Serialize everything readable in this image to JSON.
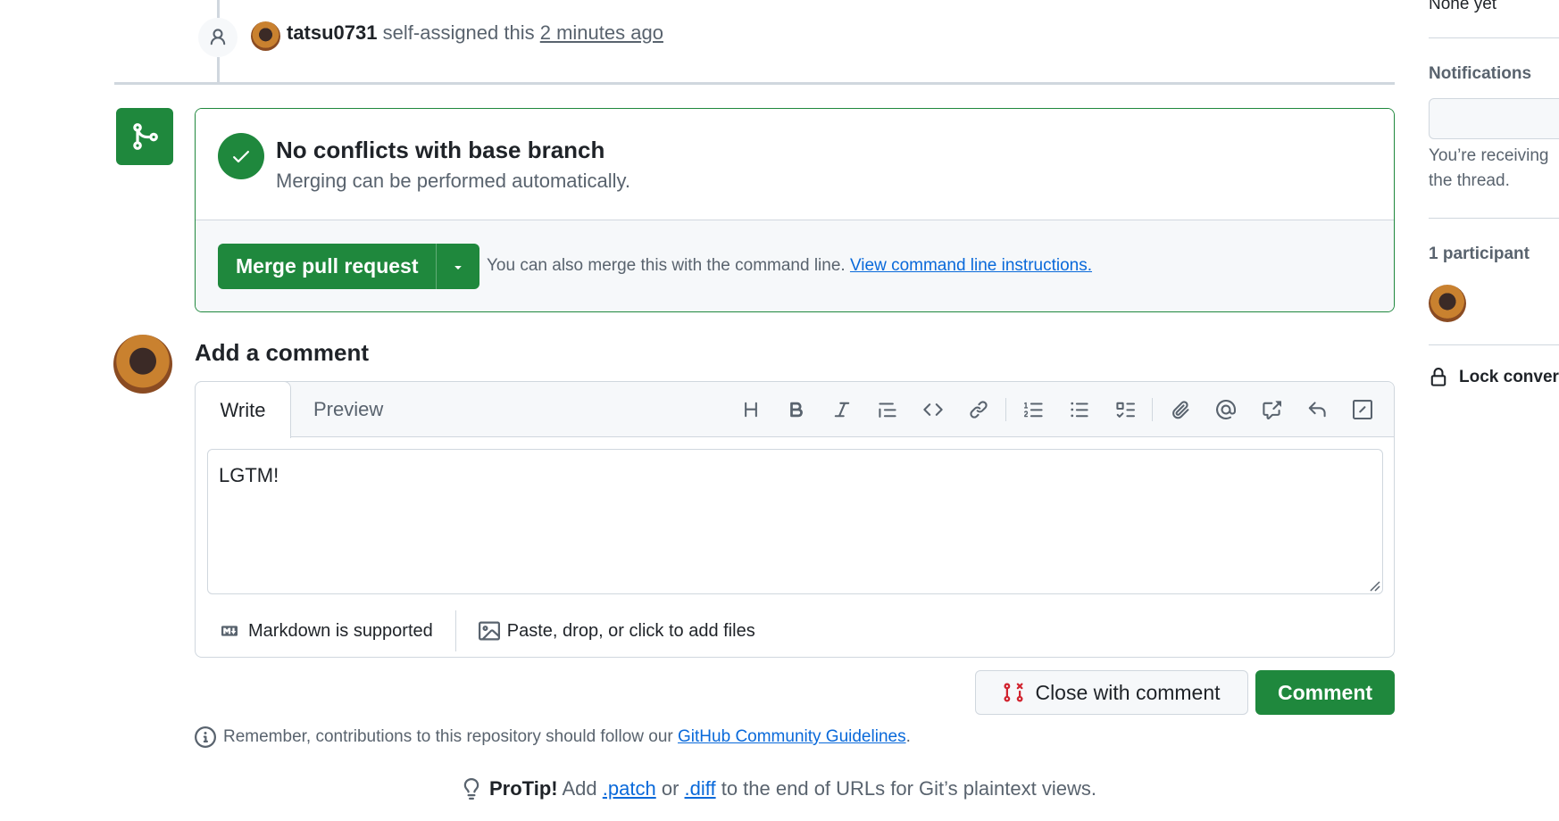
{
  "timeline_event": {
    "username": "tatsu0731",
    "action": "self-assigned this",
    "time": "2 minutes ago"
  },
  "merge": {
    "title": "No conflicts with base branch",
    "subtitle": "Merging can be performed automatically.",
    "button_label": "Merge pull request",
    "cli_text": "You can also merge this with the command line.",
    "cli_link": "View command line instructions."
  },
  "comment": {
    "heading": "Add a comment",
    "tabs": {
      "write": "Write",
      "preview": "Preview"
    },
    "toolbar": [
      "heading-icon",
      "bold-icon",
      "italic-icon",
      "quote-icon",
      "code-icon",
      "link-icon",
      "ordered-list-icon",
      "unordered-list-icon",
      "task-list-icon",
      "attach-icon",
      "mention-icon",
      "cross-reference-icon",
      "saved-reply-icon",
      "slash-command-icon"
    ],
    "text": "LGTM!",
    "markdown_note": "Markdown is supported",
    "files_note": "Paste, drop, or click to add files",
    "close_button": "Close with comment",
    "comment_button": "Comment"
  },
  "guidelines": {
    "text": "Remember, contributions to this repository should follow our",
    "link": "GitHub Community Guidelines",
    "end": "."
  },
  "protip": {
    "label": "ProTip!",
    "add": "Add",
    "patch": ".patch",
    "or": "or",
    "diff": ".diff",
    "rest": "to the end of URLs for Git’s plaintext views."
  },
  "sidebar": {
    "milestone_value": "None yet",
    "notifications_heading": "Notifications",
    "notifications_text_1": "You’re receiving",
    "notifications_text_2": "the thread.",
    "participants_heading": "1 participant",
    "lock_label": "Lock conver"
  },
  "colors": {
    "primary_green": "#1f883d",
    "link_blue": "#0969da",
    "danger_red": "#d1242f",
    "border": "#d0d7de",
    "muted_text": "#59636e"
  }
}
